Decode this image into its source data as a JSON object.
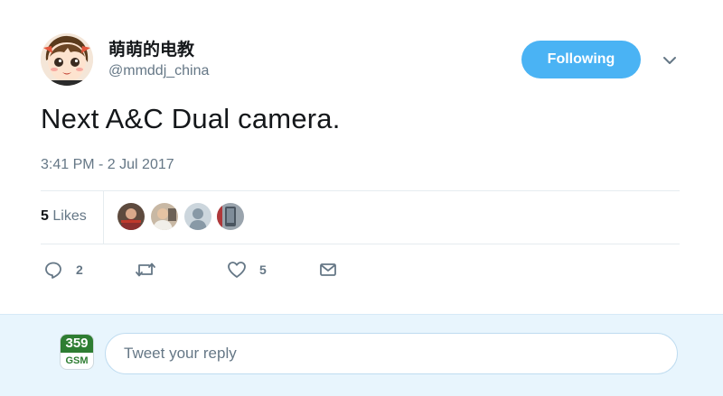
{
  "author": {
    "display_name": "萌萌的电教",
    "username": "@mmddj_china",
    "avatar_icon": "anime-girl-avatar"
  },
  "follow_button": {
    "label": "Following",
    "color": "#4ab3f4"
  },
  "menu_icon": "chevron-down-icon",
  "tweet": {
    "text": "Next A&C Dual camera.",
    "timestamp": "3:41 PM - 2 Jul 2017"
  },
  "stats": {
    "likes_count": "5",
    "likes_label": "Likes"
  },
  "likers": [
    {
      "icon": "liker-avatar-1"
    },
    {
      "icon": "liker-avatar-2"
    },
    {
      "icon": "default-avatar"
    },
    {
      "icon": "liker-avatar-4"
    }
  ],
  "actions": {
    "reply_count": "2",
    "retweet_count": "",
    "like_count": "5"
  },
  "reply_box": {
    "placeholder": "Tweet your reply",
    "badge_top": "359",
    "badge_bottom": "GSM"
  },
  "colors": {
    "accent": "#1da1f2",
    "reply_bar_bg": "#e8f5fd",
    "badge_green": "#2e7d32"
  }
}
